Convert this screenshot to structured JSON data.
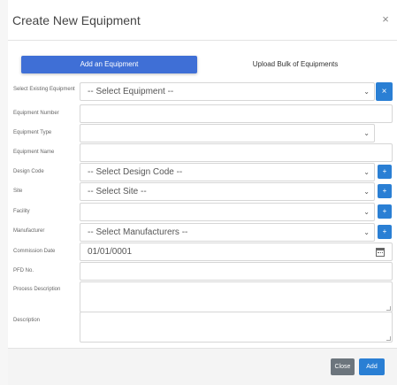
{
  "modal": {
    "title": "Create New Equipment",
    "close_glyph": "×"
  },
  "tabs": {
    "add": "Add an Equipment",
    "bulk": "Upload Bulk of Equipments"
  },
  "form": {
    "existing_label": "Select Existing Equipment",
    "existing_value": "-- Select Equipment --",
    "number_label": "Equipment Number",
    "number_value": "",
    "type_label": "Equipment Type",
    "type_value": "",
    "name_label": "Equipment Name",
    "name_value": "",
    "design_label": "Design Code",
    "design_value": "-- Select Design Code --",
    "site_label": "Site",
    "site_value": "-- Select Site --",
    "facility_label": "Facility",
    "facility_value": "",
    "manufacturer_label": "Manufacturer",
    "manufacturer_value": "-- Select Manufacturers --",
    "commission_label": "Commission Date",
    "commission_value": "01/01/0001",
    "pfd_label": "PFD No.",
    "pfd_value": "",
    "process_label": "Process Description",
    "process_value": "",
    "description_label": "Description",
    "description_value": ""
  },
  "icons": {
    "chevron": "⌄",
    "plus": "+",
    "clear": "×"
  },
  "footer": {
    "close_label": "Close",
    "add_label": "Add"
  },
  "colors": {
    "primary": "#2a7fd4",
    "tab_active": "#3f6fd6",
    "secondary": "#6c757d"
  }
}
